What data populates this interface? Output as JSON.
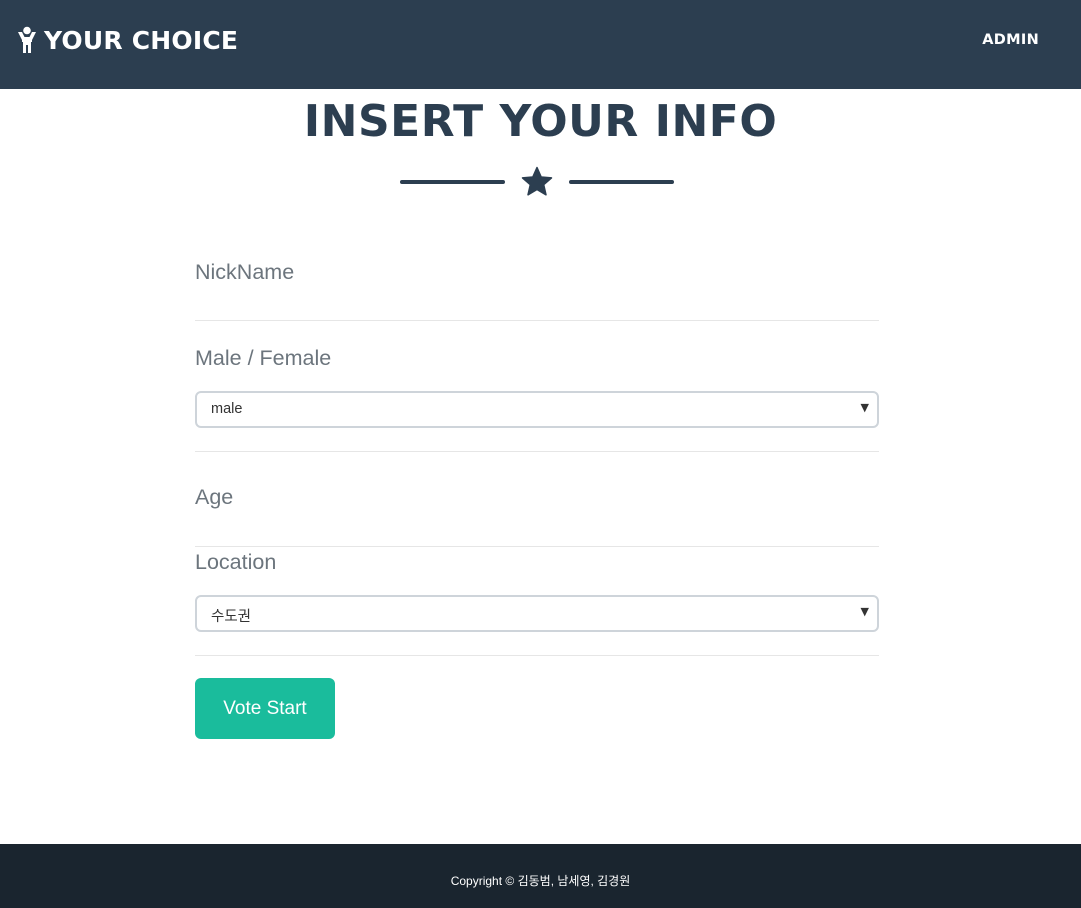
{
  "navbar": {
    "brand_icon": "person-standing-icon",
    "brand_text": "YOUR CHOICE",
    "admin_link": "ADMIN",
    "background": "#2c3e50"
  },
  "page": {
    "title": "INSERT YOUR INFO",
    "divider_icon": "star-icon"
  },
  "form": {
    "nickname_label": "NickName",
    "gender_label": "Male / Female",
    "gender_value": "male",
    "age_label": "Age",
    "location_label": "Location",
    "location_value": "수도권",
    "submit_label": "Vote Start"
  },
  "footer": {
    "copyright": "Copyright © 김동범, 남세영, 김경원",
    "background": "#1a252f"
  },
  "colors": {
    "primary": "#2c3e50",
    "accent": "#1abc9c",
    "label": "#6c757d"
  }
}
